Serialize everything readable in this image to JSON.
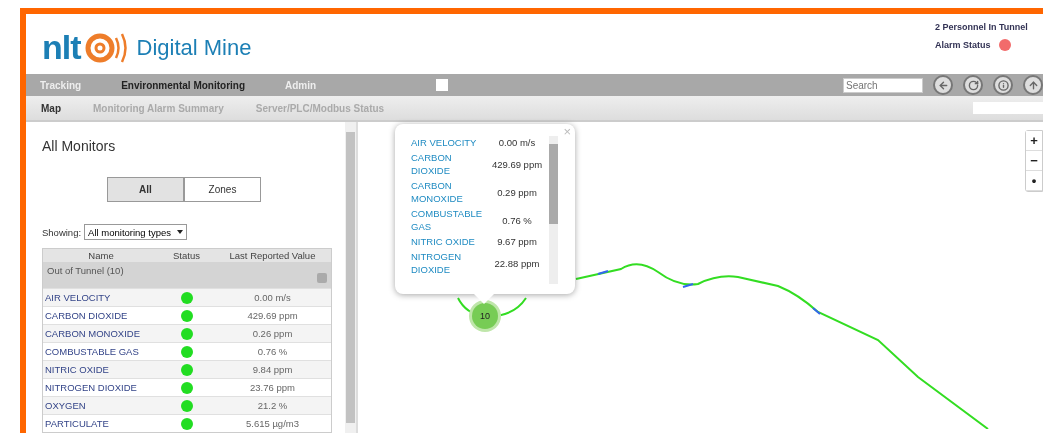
{
  "header": {
    "logo_text": "nlt",
    "product": "Digital Mine",
    "personnel": "2 Personnel In Tunnel",
    "alarm_label": "Alarm Status",
    "alarm_on": true
  },
  "toolbar_checkbox": {
    "checked": false
  },
  "nav": [
    {
      "label": "Tracking",
      "selected": false
    },
    {
      "label": "Environmental Monitoring",
      "selected": true
    },
    {
      "label": "Admin",
      "selected": false
    }
  ],
  "search": {
    "placeholder": "Search"
  },
  "subnav": [
    {
      "label": "Map",
      "selected": true
    },
    {
      "label": "Monitoring Alarm Summary",
      "selected": false
    },
    {
      "label": "Server/PLC/Modbus Status",
      "selected": false
    }
  ],
  "panel": {
    "title": "All Monitors",
    "toggle": [
      {
        "label": "All",
        "selected": true
      },
      {
        "label": "Zones",
        "selected": false
      }
    ],
    "filter_label": "Showing:",
    "filter_value": "All monitoring types",
    "columns": [
      "Name",
      "Status",
      "Last Reported Value"
    ],
    "group": "Out of Tunnel (10)",
    "rows": [
      {
        "name": "AIR VELOCITY",
        "color": "#22dd22",
        "value": "0.00 m/s"
      },
      {
        "name": "CARBON DIOXIDE",
        "color": "#22dd22",
        "value": "429.69 ppm"
      },
      {
        "name": "CARBON MONOXIDE",
        "color": "#22dd22",
        "value": "0.26 ppm"
      },
      {
        "name": "COMBUSTABLE GAS",
        "color": "#22dd22",
        "value": "0.76 %"
      },
      {
        "name": "NITRIC OXIDE",
        "color": "#22dd22",
        "value": "9.84 ppm"
      },
      {
        "name": "NITROGEN DIOXIDE",
        "color": "#22dd22",
        "value": "23.76 ppm"
      },
      {
        "name": "OXYGEN",
        "color": "#22dd22",
        "value": "21.2 %"
      },
      {
        "name": "PARTICULATE",
        "color": "#22dd22",
        "value": "5.615 µg/m3"
      }
    ]
  },
  "popup": {
    "close": "×",
    "rows": [
      {
        "name": "AIR VELOCITY",
        "value": "0.00 m/s"
      },
      {
        "name": "CARBON DIOXIDE",
        "value": "429.69 ppm"
      },
      {
        "name": "CARBON MONOXIDE",
        "value": "0.29 ppm"
      },
      {
        "name": "COMBUSTABLE GAS",
        "value": "0.76 %"
      },
      {
        "name": "NITRIC OXIDE",
        "value": "9.67 ppm"
      },
      {
        "name": "NITROGEN DIOXIDE",
        "value": "22.88 ppm"
      }
    ]
  },
  "map": {
    "node": "10",
    "zoom": [
      "+",
      "−",
      "•"
    ]
  }
}
